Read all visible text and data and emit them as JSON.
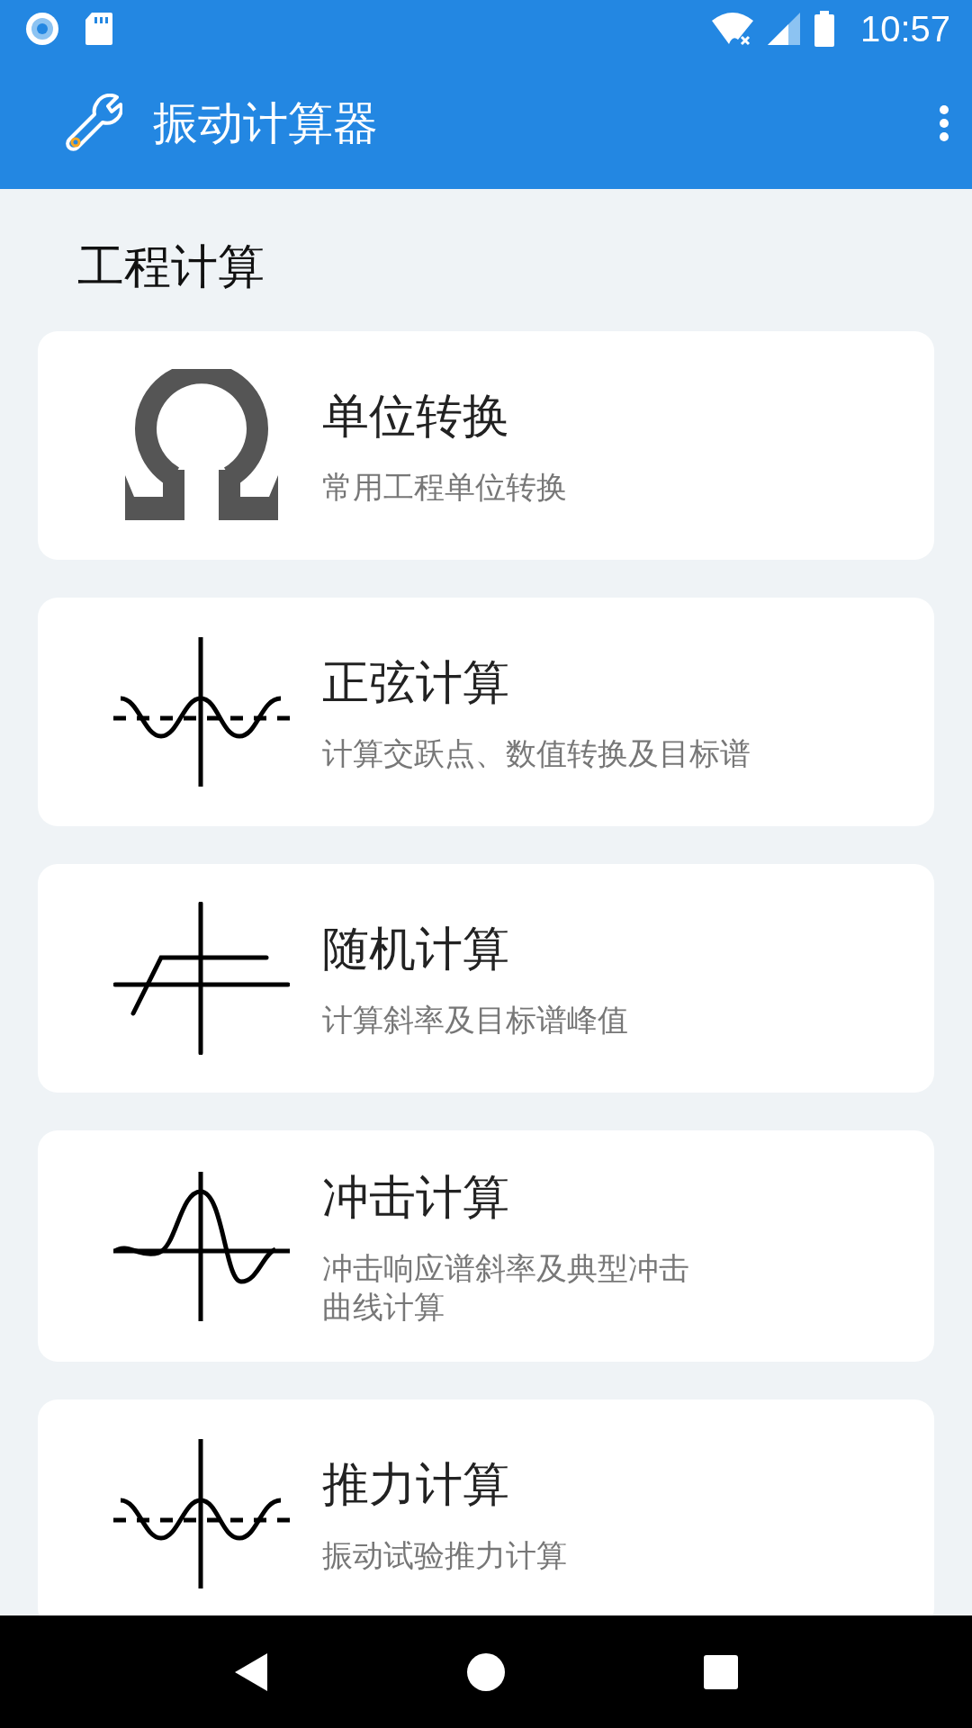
{
  "status_bar": {
    "time": "10:57"
  },
  "app_bar": {
    "title": "振动计算器"
  },
  "section": {
    "title": "工程计算"
  },
  "cards": [
    {
      "kind": "omega",
      "title": "单位转换",
      "subtitle": [
        "常用工程单位转换"
      ]
    },
    {
      "kind": "sine",
      "title": "正弦计算",
      "subtitle": [
        "计算交跃点、数值转换及目标谱"
      ]
    },
    {
      "kind": "random",
      "title": "随机计算",
      "subtitle": [
        "计算斜率及目标谱峰值"
      ]
    },
    {
      "kind": "shock",
      "title": "冲击计算",
      "subtitle": [
        "冲击响应谱斜率及典型冲击",
        "曲线计算"
      ]
    },
    {
      "kind": "sine",
      "title": "推力计算",
      "subtitle": [
        "振动试验推力计算"
      ]
    }
  ]
}
